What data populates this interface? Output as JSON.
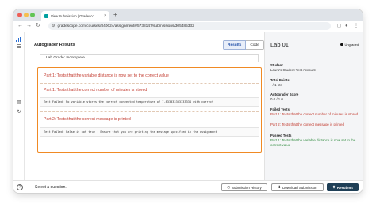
{
  "browser": {
    "tab_title": "View Submission | Gradesco...",
    "tab_close": "×",
    "new_tab": "+",
    "url": "gradescope.com/courses/840624/assignments/5738147/submissions/305485332"
  },
  "main": {
    "section_title": "Autograder Results",
    "view_buttons": [
      "Results",
      "Code"
    ],
    "autograder_grade": "Lab Grade: Incomplete",
    "tests": [
      {
        "title": "Part 1: Tests that the variable distance is now set to the correct value",
        "output": ""
      },
      {
        "title": "Part 1: Tests that the correct number of minutes is stored",
        "output": "Test Failed: No variable stores the correct converted temperature of 7.833333333333334 with correct"
      },
      {
        "title": "Part 2: Tests that the correct message is printed",
        "output": "Test Failed: False is not true : Ensure that you are printing the message specified in the assignment"
      }
    ]
  },
  "sidebar": {
    "title": "Lab 01",
    "status": "Ungraded",
    "student_label": "Student",
    "student_value": "Laura's Student Test Account",
    "total_points_label": "Total Points",
    "total_points_value": "- / 1 pts",
    "autograder_score_label": "Autograder Score",
    "autograder_score_value": "0.0 / 1.0",
    "failed_tests_label": "Failed Tests",
    "failed_tests": [
      "Part 1: Tests that the correct number of minutes is stored",
      "Part 2: Tests that the correct message is printed"
    ],
    "passed_tests_label": "Passed Tests",
    "passed_tests": [
      "Part 1: Tests that the variable distance is now set to the correct value"
    ]
  },
  "footer": {
    "message": "Select a question.",
    "submission_history": "Submission History",
    "download_submission": "Download Submission",
    "resubmit": "Resubmit"
  },
  "colors": {
    "accent_orange": "#f08a24",
    "fail_red": "#c23a2e",
    "pass_green": "#2f8a3e",
    "resubmit_bg": "#1f3f56"
  },
  "icons": [
    "stats-icon",
    "chevron-icon",
    "list-icon",
    "refresh-icon",
    "help-icon",
    "clock-icon",
    "download-icon",
    "upload-icon",
    "lock-icon"
  ]
}
